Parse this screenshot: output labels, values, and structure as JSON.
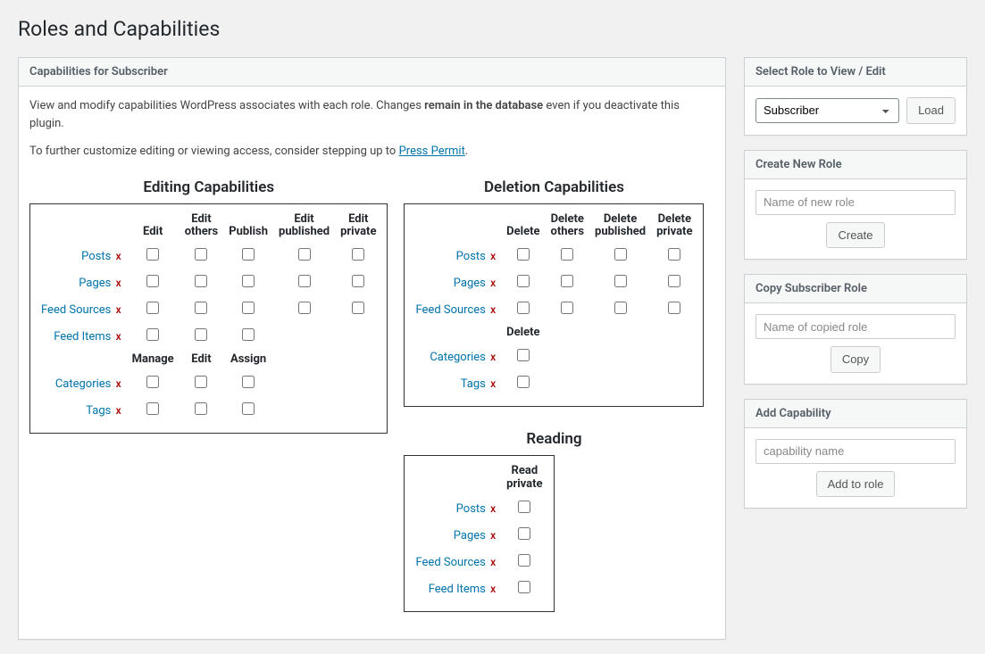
{
  "page_title": "Roles and Capabilities",
  "main": {
    "header": "Capabilities for Subscriber",
    "desc1_a": "View and modify capabilities WordPress associates with each role. Changes ",
    "desc1_strong": "remain in the database",
    "desc1_b": " even if you deactivate this plugin.",
    "desc2_a": "To further customize editing or viewing access, consider stepping up to ",
    "desc2_link": "Press Permit",
    "desc2_b": ".",
    "x": "x",
    "editing": {
      "title": "Editing Capabilities",
      "cols1": [
        "Edit",
        "Edit others",
        "Publish",
        "Edit published",
        "Edit private"
      ],
      "rows1": [
        "Posts",
        "Pages",
        "Feed Sources",
        "Feed Items"
      ],
      "feed_items_cols": 3,
      "cols2": [
        "Manage",
        "Edit",
        "Assign"
      ],
      "rows2": [
        "Categories",
        "Tags"
      ]
    },
    "deletion": {
      "title": "Deletion Capabilities",
      "cols1": [
        "Delete",
        "Delete others",
        "Delete published",
        "Delete private"
      ],
      "rows1": [
        "Posts",
        "Pages",
        "Feed Sources"
      ],
      "cols2": [
        "Delete"
      ],
      "rows2": [
        "Categories",
        "Tags"
      ]
    },
    "reading": {
      "title": "Reading",
      "cols": [
        "Read private"
      ],
      "rows": [
        "Posts",
        "Pages",
        "Feed Sources",
        "Feed Items"
      ]
    }
  },
  "side": {
    "select_role": {
      "header": "Select Role to View / Edit",
      "value": "Subscriber",
      "load": "Load"
    },
    "create_role": {
      "header": "Create New Role",
      "placeholder": "Name of new role",
      "button": "Create"
    },
    "copy_role": {
      "header": "Copy Subscriber Role",
      "placeholder": "Name of copied role",
      "button": "Copy"
    },
    "add_cap": {
      "header": "Add Capability",
      "placeholder": "capability name",
      "button": "Add to role"
    }
  }
}
